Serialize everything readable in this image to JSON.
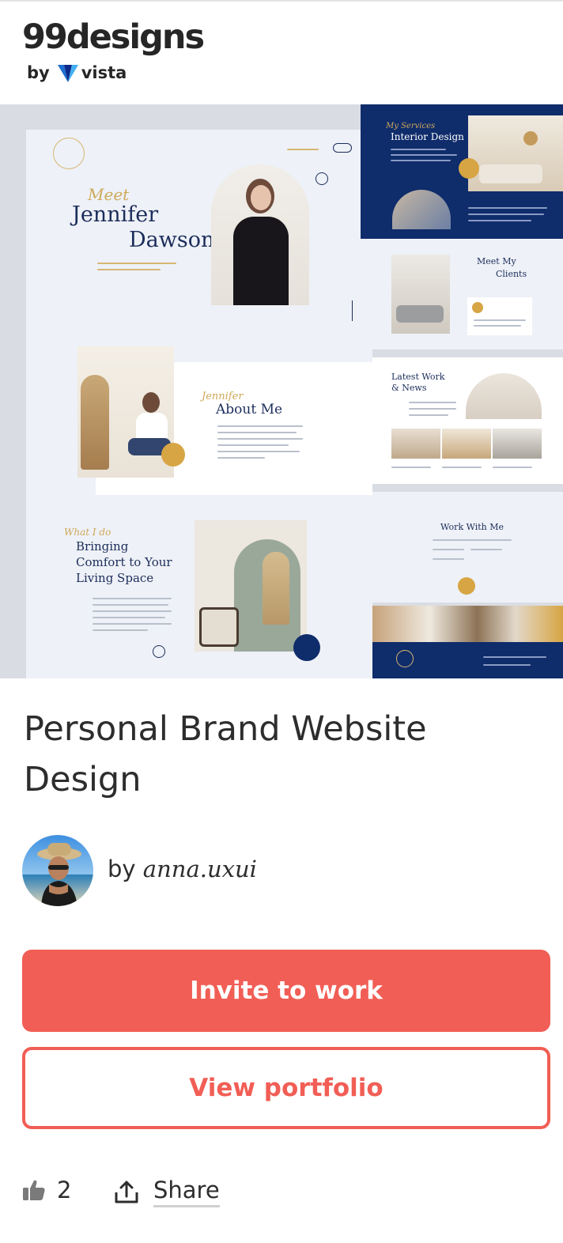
{
  "logo": {
    "wordmark": "99designs",
    "by": "by",
    "partner": "vista"
  },
  "mockup": {
    "hero_script": "Meet",
    "hero_name_first": "Jennifer",
    "hero_name_last": "Dawson",
    "about_script": "Jennifer",
    "about_title": "About Me",
    "what_script": "What I do",
    "what_title_1": "Bringing",
    "what_title_2": "Comfort to Your",
    "what_title_3": "Living Space",
    "services_script": "My Services",
    "services_title": "Interior Design",
    "clients_script": "Meet My",
    "clients_title": "Clients",
    "news_title_1": "Latest Work",
    "news_title_2": "& News",
    "work_title": "Work With Me"
  },
  "project": {
    "title": "Personal Brand Website Design"
  },
  "author": {
    "by": "by",
    "name": "anna.uxui"
  },
  "actions": {
    "invite_label": "Invite to work",
    "portfolio_label": "View portfolio",
    "like_count": "2",
    "share_label": "Share"
  },
  "colors": {
    "accent": "#f15e55",
    "navy": "#0f2c6b",
    "gold": "#d7a543"
  },
  "icons": {
    "like": "thumbs-up-icon",
    "share": "share-icon",
    "vista": "vista-logo-icon"
  }
}
